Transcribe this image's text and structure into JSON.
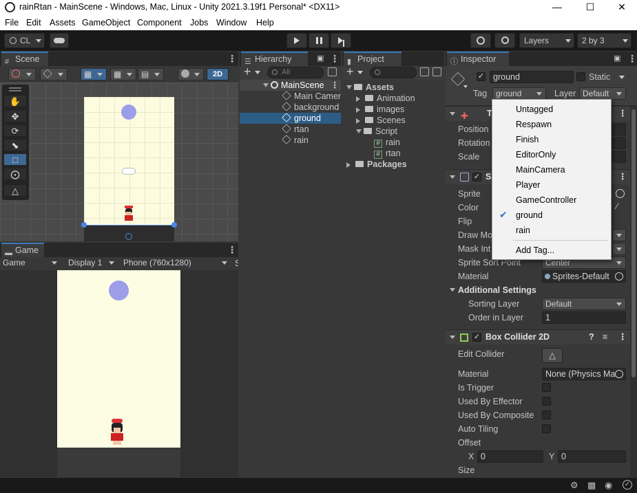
{
  "titlebar": {
    "title": "rainRtan - MainScene - Windows, Mac, Linux - Unity 2021.3.19f1 Personal* <DX11>"
  },
  "menu": [
    "File",
    "Edit",
    "Assets",
    "GameObject",
    "Component",
    "Jobs",
    "Window",
    "Help"
  ],
  "toolbar": {
    "account": "CL",
    "layers": "Layers",
    "layout": "2 by 3"
  },
  "scene": {
    "tab": "Scene",
    "mode2d": "2D"
  },
  "game": {
    "tab": "Game",
    "display_mode": "Game",
    "display": "Display 1",
    "resolution": "Phone (760x1280)",
    "extra": "S"
  },
  "hierarchy": {
    "tab": "Hierarchy",
    "search_placeholder": "All",
    "scene": "MainScene",
    "items": [
      "Main Camer",
      "background",
      "ground",
      "rtan",
      "rain"
    ]
  },
  "project": {
    "tab": "Project",
    "assets": "Assets",
    "folders": [
      "Animation",
      "images",
      "Scenes",
      "Script"
    ],
    "scripts": [
      "rain",
      "rtan"
    ],
    "packages": "Packages"
  },
  "inspector": {
    "tab": "Inspector",
    "name": "ground",
    "static_label": "Static",
    "tag_label": "Tag",
    "tag_value": "ground",
    "layer_label": "Layer",
    "layer_value": "Default",
    "transform": {
      "title": "T",
      "position": "Position",
      "rotation": "Rotation",
      "scale": "Scale"
    },
    "sprite_renderer": {
      "title": "S",
      "sprite": "Sprite",
      "color": "Color",
      "flip": "Flip",
      "draw_mode": "Draw Mo",
      "mask": "Mask Int",
      "sort_point": "Sprite Sort Point",
      "sort_point_value": "Center",
      "material": "Material",
      "material_value": "Sprites-Default",
      "additional": "Additional Settings",
      "sorting_layer": "Sorting Layer",
      "sorting_layer_value": "Default",
      "order": "Order in Layer",
      "order_value": "1"
    },
    "box_collider": {
      "title": "Box Collider 2D",
      "edit": "Edit Collider",
      "material": "Material",
      "material_value": "None (Physics Ma",
      "trigger": "Is Trigger",
      "effector": "Used By Effector",
      "composite": "Used By Composite",
      "tiling": "Auto Tiling",
      "offset": "Offset",
      "x_label": "X",
      "x_value": "0",
      "y_label": "Y",
      "y_value": "0",
      "size": "Size"
    }
  },
  "tag_menu": {
    "items": [
      "Untagged",
      "Respawn",
      "Finish",
      "EditorOnly",
      "MainCamera",
      "Player",
      "GameController",
      "ground",
      "rain"
    ],
    "selected": "ground",
    "add": "Add Tag..."
  }
}
